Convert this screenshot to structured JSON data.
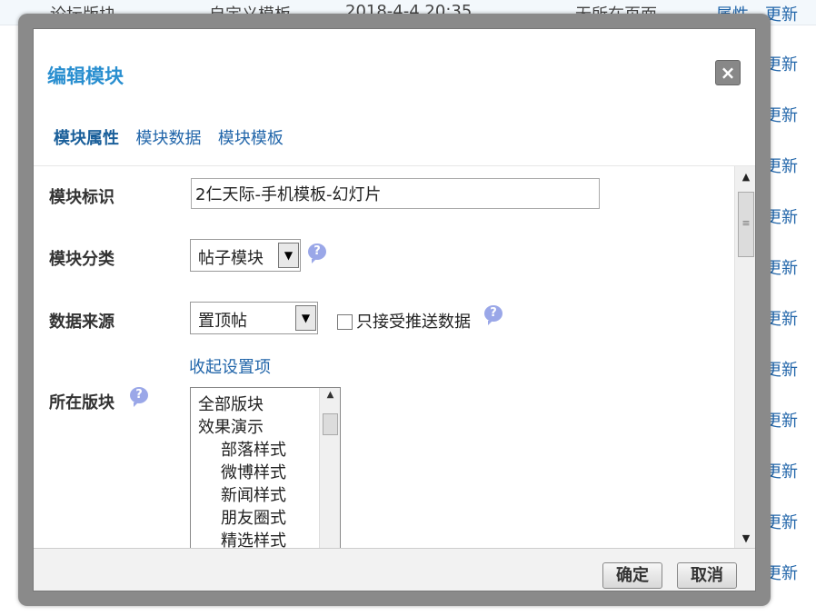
{
  "background": {
    "first_row": {
      "name": "论坛版块",
      "type": "自定义模板",
      "time": "2018-4-4 20:35",
      "location": "无所在页面",
      "attr_link": "属性",
      "update_link": "更新"
    },
    "update_links": [
      "更新",
      "更新",
      "更新",
      "更新",
      "更新",
      "更新",
      "更新",
      "更新",
      "更新",
      "更新",
      "更新",
      "更新"
    ]
  },
  "dialog": {
    "title": "编辑模块",
    "close_label": "×",
    "tabs": [
      {
        "label": "模块属性",
        "active": true
      },
      {
        "label": "模块数据",
        "active": false
      },
      {
        "label": "模块模板",
        "active": false
      }
    ],
    "form": {
      "module_id_label": "模块标识",
      "module_id_value": "2仁天际-手机模板-幻灯片",
      "module_category_label": "模块分类",
      "module_category_value": "帖子模块",
      "data_source_label": "数据来源",
      "data_source_value": "置顶帖",
      "push_only_label": "只接受推送数据",
      "collapse_link": "收起设置项",
      "forum_label": "所在版块",
      "forum_options": [
        {
          "label": "全部版块",
          "indent": false
        },
        {
          "label": "效果演示",
          "indent": false
        },
        {
          "label": "部落样式",
          "indent": true
        },
        {
          "label": "微博样式",
          "indent": true
        },
        {
          "label": "新闻样式",
          "indent": true
        },
        {
          "label": "朋友圈式",
          "indent": true
        },
        {
          "label": "精选样式",
          "indent": true
        }
      ]
    },
    "footer": {
      "confirm_label": "确定",
      "cancel_label": "取消"
    },
    "icons": {
      "help": "help-bubble-icon",
      "close": "close-icon"
    },
    "colors": {
      "title": "#2a8fd0",
      "link": "#2266aa",
      "frame": "#8a8a8a"
    }
  }
}
